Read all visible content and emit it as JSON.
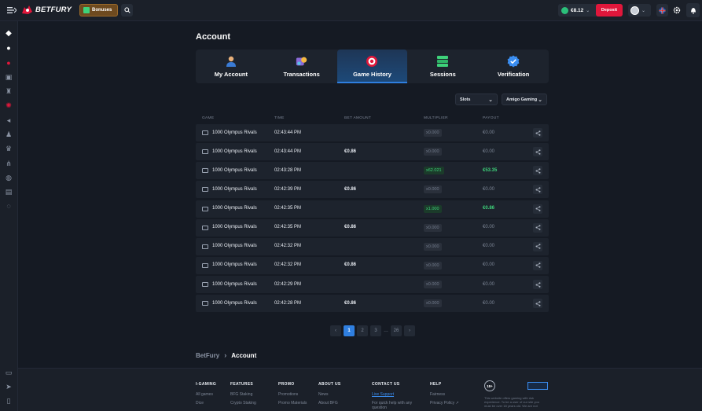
{
  "header": {
    "logo_text": "BETFURY",
    "bonuses_label": "Bonuses",
    "balance": "€8.12",
    "deposit_label": "Deposit",
    "colors": {
      "deposit": "#e0173b",
      "accent": "#2f7fe0",
      "win": "#3ed27a"
    }
  },
  "page": {
    "title": "Account"
  },
  "tabs": [
    {
      "label": "My Account",
      "icon": "user-icon"
    },
    {
      "label": "Transactions",
      "icon": "transactions-icon"
    },
    {
      "label": "Game History",
      "icon": "target-icon"
    },
    {
      "label": "Sessions",
      "icon": "stack-icon"
    },
    {
      "label": "Verification",
      "icon": "verified-badge-icon"
    }
  ],
  "active_tab": "Game History",
  "filters": {
    "category": "Slots",
    "provider": "Amigo Gaming"
  },
  "table": {
    "columns": [
      "GAME",
      "TIME",
      "BET AMOUNT",
      "MULTIPLIER",
      "PAYOUT"
    ],
    "rows": [
      {
        "game": "1000 Olympus Rivals",
        "time": "02:43:44 PM",
        "bet": "",
        "multiplier": "x0.000",
        "payout": "€0.00",
        "win": false
      },
      {
        "game": "1000 Olympus Rivals",
        "time": "02:43:44 PM",
        "bet": "€0.86",
        "multiplier": "x0.000",
        "payout": "€0.00",
        "win": false
      },
      {
        "game": "1000 Olympus Rivals",
        "time": "02:43:28 PM",
        "bet": "",
        "multiplier": "x62.021",
        "payout": "€53.35",
        "win": true
      },
      {
        "game": "1000 Olympus Rivals",
        "time": "02:42:39 PM",
        "bet": "€0.86",
        "multiplier": "x0.000",
        "payout": "€0.00",
        "win": false
      },
      {
        "game": "1000 Olympus Rivals",
        "time": "02:42:35 PM",
        "bet": "",
        "multiplier": "x1.000",
        "payout": "€0.86",
        "win": true
      },
      {
        "game": "1000 Olympus Rivals",
        "time": "02:42:35 PM",
        "bet": "€0.86",
        "multiplier": "x0.000",
        "payout": "€0.00",
        "win": false
      },
      {
        "game": "1000 Olympus Rivals",
        "time": "02:42:32 PM",
        "bet": "",
        "multiplier": "x0.000",
        "payout": "€0.00",
        "win": false
      },
      {
        "game": "1000 Olympus Rivals",
        "time": "02:42:32 PM",
        "bet": "€0.86",
        "multiplier": "x0.000",
        "payout": "€0.00",
        "win": false
      },
      {
        "game": "1000 Olympus Rivals",
        "time": "02:42:29 PM",
        "bet": "",
        "multiplier": "x0.000",
        "payout": "€0.00",
        "win": false
      },
      {
        "game": "1000 Olympus Rivals",
        "time": "02:42:28 PM",
        "bet": "€0.86",
        "multiplier": "x0.000",
        "payout": "€0.00",
        "win": false
      }
    ]
  },
  "pagination": {
    "prev": "‹",
    "pages": [
      "1",
      "2",
      "3"
    ],
    "dots": "…",
    "last": "26",
    "next": "›",
    "current": "1"
  },
  "breadcrumb": {
    "parent": "BetFury",
    "current": "Account"
  },
  "footer": {
    "columns": [
      {
        "heading": "I-GAMING",
        "links": [
          "All games",
          "Dice"
        ]
      },
      {
        "heading": "FEATURES",
        "links": [
          "BFG Staking",
          "Crypto Staking"
        ]
      },
      {
        "heading": "PROMO",
        "links": [
          "Promotions",
          "Promo Materials"
        ]
      },
      {
        "heading": "ABOUT US",
        "links": [
          "News",
          "About BFG"
        ]
      },
      {
        "heading": "CONTACT US",
        "links": [
          "Live Support",
          "For quick help with any question"
        ]
      },
      {
        "heading": "HELP",
        "links": [
          "Fairness",
          "Privacy Policy ↗"
        ]
      }
    ],
    "age_badge": "18+",
    "disclaimer": "This website offers gaming with risk experience. To be a user of our site you must be over 18 years old. We are not"
  }
}
